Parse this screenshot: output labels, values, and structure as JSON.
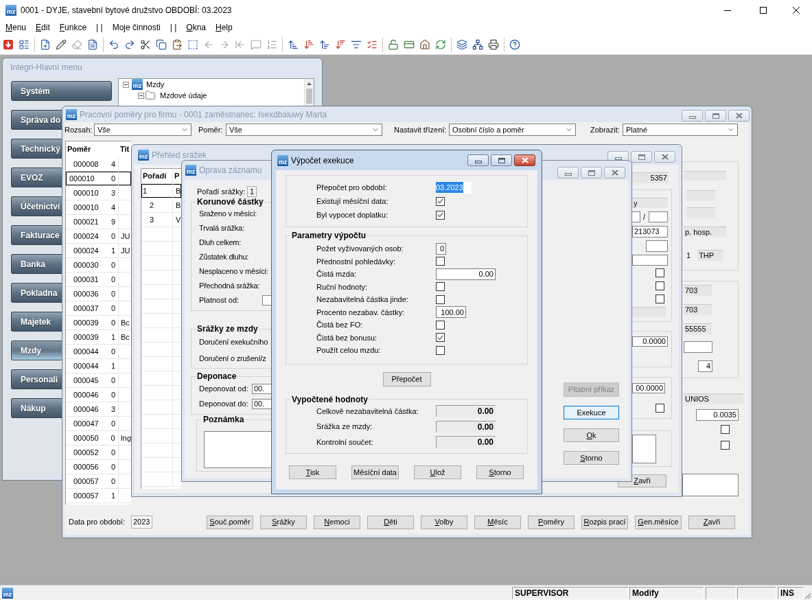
{
  "app": {
    "logo": "mz",
    "title": "0001 - DYJE, stavební bytové družstvo OBDOBÍ: 03.2023"
  },
  "menu_bar": [
    {
      "label": "Menu",
      "mnemonic": true
    },
    {
      "label": "Edit",
      "mnemonic": true
    },
    {
      "label": "Funkce",
      "mnemonic": true
    },
    {
      "label": "| |"
    },
    {
      "label": "Moje činnosti",
      "mnemonic": false
    },
    {
      "label": "| |"
    },
    {
      "label": "Okna",
      "mnemonic": true
    },
    {
      "label": "Help",
      "mnemonic": true
    }
  ],
  "toolbar": [
    {
      "items": [
        {
          "kind": "import",
          "disabled": false
        },
        {
          "kind": "form",
          "disabled": false
        }
      ]
    },
    {
      "items": [
        {
          "kind": "new",
          "disabled": false
        },
        {
          "kind": "edit",
          "disabled": false
        },
        {
          "kind": "erase",
          "disabled": true
        },
        {
          "kind": "list",
          "disabled": false
        }
      ]
    },
    {
      "items": [
        {
          "kind": "undo",
          "disabled": false
        },
        {
          "kind": "redo",
          "disabled": false
        },
        {
          "kind": "cut",
          "disabled": false
        },
        {
          "kind": "copy",
          "disabled": false
        },
        {
          "kind": "paste",
          "disabled": false
        },
        {
          "kind": "select",
          "disabled": false
        },
        {
          "kind": "back",
          "disabled": true
        },
        {
          "kind": "forward",
          "disabled": true
        },
        {
          "kind": "outdent",
          "disabled": true
        },
        {
          "kind": "comment",
          "disabled": true
        },
        {
          "kind": "numbered",
          "disabled": true
        }
      ]
    },
    {
      "items": [
        {
          "kind": "sort_up",
          "disabled": false
        },
        {
          "kind": "sort_down",
          "disabled": false
        },
        {
          "kind": "sort_up_wide",
          "disabled": false
        },
        {
          "kind": "sort_down_wide",
          "disabled": false
        },
        {
          "kind": "filter",
          "disabled": false
        },
        {
          "kind": "checklist",
          "disabled": false
        }
      ]
    },
    {
      "items": [
        {
          "kind": "unlock",
          "disabled": false
        },
        {
          "kind": "card",
          "disabled": false
        },
        {
          "kind": "home",
          "disabled": false
        },
        {
          "kind": "refresh",
          "disabled": false
        }
      ]
    },
    {
      "items": [
        {
          "kind": "layers",
          "disabled": false
        },
        {
          "kind": "network",
          "disabled": false
        },
        {
          "kind": "printer",
          "disabled": false
        }
      ]
    },
    {
      "items": [
        {
          "kind": "help",
          "disabled": false
        }
      ]
    }
  ],
  "main_menu": {
    "title": "Integri-Hlavní menu",
    "active": false,
    "modules": [
      {
        "label": "Systém",
        "selected": false
      },
      {
        "label": "Správa do",
        "selected": false
      },
      {
        "label": "Technický",
        "selected": false
      },
      {
        "label": "EVOZ",
        "selected": false
      },
      {
        "label": "Účetnictví",
        "selected": false
      },
      {
        "label": "Fakturace",
        "selected": false
      },
      {
        "label": "Banka",
        "selected": false
      },
      {
        "label": "Pokladna",
        "selected": false
      },
      {
        "label": "Majetek",
        "selected": false
      },
      {
        "label": "Mzdy",
        "selected": true
      },
      {
        "label": "Personali",
        "selected": false
      },
      {
        "label": "Nákup",
        "selected": false
      }
    ],
    "tree": [
      {
        "label": "Mzdy",
        "logo": "mz",
        "expanded": true,
        "children": [
          {
            "label": "Mzdové údaje",
            "expanded": true
          }
        ]
      }
    ]
  },
  "employment_window": {
    "logo": "mz",
    "title": "Pracovní poměry pro firmu - 0001 zaměstnanec: Isexdbaluwý Marta",
    "active": false,
    "filters": [
      {
        "label": "Rozsah:",
        "value": "Vše"
      },
      {
        "label": "Poměr:",
        "value": "Vše"
      },
      {
        "label": "Nastavit třízení:",
        "value": "Osobní číslo a poměr"
      },
      {
        "label": "Zobrazit:",
        "value": "Platné"
      }
    ],
    "table": {
      "columns": [
        "Poměr",
        "Tit"
      ],
      "rows": [
        {
          "number": "000008",
          "order": "4",
          "selected": false
        },
        {
          "number": "000010",
          "order": "0",
          "selected": true
        },
        {
          "number": "000010",
          "order": "3",
          "selected": false
        },
        {
          "number": "000010",
          "order": "4",
          "selected": false
        },
        {
          "number": "000021",
          "order": "9",
          "selected": false
        },
        {
          "number": "000024",
          "order": "0",
          "title": "JU",
          "selected": false
        },
        {
          "number": "000024",
          "order": "1",
          "title": "JU",
          "selected": false
        },
        {
          "number": "000030",
          "order": "0",
          "selected": false
        },
        {
          "number": "000031",
          "order": "0",
          "selected": false
        },
        {
          "number": "000036",
          "order": "0",
          "selected": false
        },
        {
          "number": "000037",
          "order": "0",
          "selected": false
        },
        {
          "number": "000039",
          "order": "0",
          "title": "Bc",
          "selected": false
        },
        {
          "number": "000039",
          "order": "1",
          "title": "Bc",
          "selected": false
        },
        {
          "number": "000044",
          "order": "0",
          "selected": false
        },
        {
          "number": "000044",
          "order": "1",
          "selected": false
        },
        {
          "number": "000045",
          "order": "0",
          "selected": false
        },
        {
          "number": "000046",
          "order": "0",
          "selected": false
        },
        {
          "number": "000046",
          "order": "3",
          "selected": false
        },
        {
          "number": "000047",
          "order": "0",
          "selected": false
        },
        {
          "number": "000050",
          "order": "0",
          "title": "Ing",
          "selected": false
        },
        {
          "number": "000052",
          "order": "0",
          "selected": false
        },
        {
          "number": "000056",
          "order": "0",
          "selected": false
        },
        {
          "number": "000057",
          "order": "0",
          "selected": false
        },
        {
          "number": "000057",
          "order": "1",
          "selected": false
        }
      ]
    },
    "details": [
      {
        "kind": "readonly"
      },
      {
        "kind": "readonly"
      },
      {
        "kind": "readonly"
      },
      {
        "kind": "readonly",
        "value": "p. hosp."
      },
      {
        "kind": "text",
        "value": "1"
      },
      {
        "kind": "readonly",
        "value": "THP"
      },
      {
        "kind": "readonly",
        "value": "703"
      },
      {
        "kind": "readonly",
        "value": "703"
      },
      {
        "kind": "readonly",
        "value": "55555"
      },
      {
        "kind": "input"
      },
      {
        "kind": "input",
        "value": "4"
      },
      {
        "kind": "readonly",
        "value": "UNIOS"
      },
      {
        "kind": "input",
        "value": "0.0035"
      },
      {
        "kind": "checkbox",
        "checked": false
      },
      {
        "kind": "checkbox",
        "checked": false
      },
      {
        "kind": "textarea"
      }
    ],
    "period": {
      "label": "Data pro období:",
      "value": "2023"
    },
    "buttons": [
      {
        "label": "Souč.poměr",
        "mnemonic": true
      },
      {
        "label": "Srážky",
        "mnemonic": true
      },
      {
        "label": "Nemoci",
        "mnemonic": true
      },
      {
        "label": "Děti",
        "mnemonic": true
      },
      {
        "label": "Volby",
        "mnemonic": true
      },
      {
        "label": "Měsíc",
        "mnemonic": true
      },
      {
        "label": "Poměry",
        "mnemonic": true
      },
      {
        "label": "Rozpis prací",
        "mnemonic": true
      },
      {
        "label": "Gen.měsíce",
        "mnemonic": true
      },
      {
        "label": "Zavři",
        "mnemonic": true
      }
    ]
  },
  "deductions_window": {
    "logo": "mz",
    "title": "Přehled srážek",
    "active": false,
    "table": {
      "columns": [
        "Pořadí",
        "P"
      ],
      "rows": [
        {
          "order": "1",
          "text": "B",
          "selected": true
        },
        {
          "order": "2",
          "text": "B",
          "selected": false
        },
        {
          "order": "3",
          "text": "V",
          "selected": false
        }
      ]
    },
    "details": [
      {
        "kind": "readonly",
        "value": "5357"
      },
      {
        "kind": "readonly",
        "value": "y"
      },
      {
        "kind": "input"
      },
      {
        "kind": "text",
        "value": "/"
      },
      {
        "kind": "input"
      },
      {
        "kind": "input",
        "value": "213073"
      },
      {
        "kind": "input"
      },
      {
        "kind": "input"
      },
      {
        "kind": "checkbox",
        "checked": false
      },
      {
        "kind": "checkbox",
        "checked": false
      },
      {
        "kind": "checkbox",
        "checked": false
      },
      {
        "kind": "readonly"
      },
      {
        "kind": "input",
        "value": "0.0000"
      },
      {
        "kind": "input",
        "value": "00.0000"
      },
      {
        "kind": "checkbox",
        "checked": false
      },
      {
        "kind": "textarea"
      }
    ],
    "buttons": [
      {
        "label": "Zavři",
        "mnemonic": true
      }
    ]
  },
  "edit_window": {
    "logo": "mz",
    "title": "Oprava záznamu",
    "active": false,
    "order": {
      "label": "Pořadí srážky:",
      "value": "1"
    },
    "groups": [
      {
        "title": "Korunové částky",
        "kind": "rows",
        "rows": [
          {
            "kind": "label",
            "label": "Sraženo v měsíci:"
          },
          {
            "kind": "label",
            "label": "Trvalá srážka:"
          },
          {
            "kind": "label",
            "label": "Dluh celkem:"
          },
          {
            "kind": "label",
            "label": "Zůstatek dluhu:"
          },
          {
            "kind": "label",
            "label": "Nesplaceno v měsíci:"
          },
          {
            "kind": "label",
            "label": "Přechodná srážka:"
          },
          {
            "kind": "field",
            "label": "Platnost od:"
          }
        ]
      },
      {
        "title": "Srážky ze mzdy",
        "kind": "rows",
        "rows": [
          {
            "kind": "label",
            "label": "Doručení exekučního"
          },
          {
            "kind": "label",
            "label": "Doručení o zrušení/z"
          }
        ]
      },
      {
        "title": "Deponace",
        "kind": "rows",
        "rows": [
          {
            "kind": "field",
            "label": "Deponovat od:",
            "value": "00."
          },
          {
            "kind": "field",
            "label": "Deponovat do:",
            "value": "00."
          }
        ]
      },
      {
        "title": "Poznámka",
        "kind": "note"
      }
    ],
    "buttons": [
      {
        "label": "Pltabní příkaz",
        "disabled": true,
        "focused": false,
        "mnemonic": false
      },
      {
        "label": "Exekuce",
        "disabled": false,
        "focused": true,
        "mnemonic": false
      },
      {
        "label": "Ok",
        "disabled": false,
        "focused": false,
        "mnemonic": true
      },
      {
        "label": "Storno",
        "disabled": false,
        "focused": false,
        "mnemonic": true
      }
    ]
  },
  "calc_dialog": {
    "logo": "mz",
    "title": "Výpočet exekuce",
    "active": true,
    "summary": [
      {
        "kind": "field",
        "label": "Přepočet pro období:",
        "value": "03.2023",
        "text_selected": true
      },
      {
        "kind": "checkbox",
        "label": "Existují měsíční data:",
        "checked": true
      },
      {
        "kind": "checkbox",
        "label": "Byl vypocet doplatku:",
        "checked": true
      }
    ],
    "parameters": {
      "title": "Parametry výpočtu",
      "rows": [
        {
          "kind": "field",
          "label": "Požet vyživovaných osob:",
          "value": "0"
        },
        {
          "kind": "checkbox",
          "label": "Přednostní pohledávky:",
          "checked": false
        },
        {
          "kind": "field",
          "label": "Čistá mzda:",
          "value": "0.00"
        },
        {
          "kind": "checkbox",
          "label": "Ruční hodnoty:",
          "checked": false
        },
        {
          "kind": "checkbox",
          "label": "Nezabavitelná částka jinde:",
          "checked": false
        },
        {
          "kind": "field",
          "label": "Procento nezabav. částky:",
          "value": "100.00"
        },
        {
          "kind": "checkbox",
          "label": "Čistá bez FO:",
          "checked": false
        },
        {
          "kind": "checkbox",
          "label": "Čistá bez bonusu:",
          "checked": true
        },
        {
          "kind": "checkbox",
          "label": "Použít celou mzdu:",
          "checked": false
        }
      ]
    },
    "recalculate": {
      "label": "Přepočet",
      "mnemonic": false
    },
    "results": {
      "title": "Vypočtené hodnoty",
      "rows": [
        {
          "label": "Celkově nezabavitelná částka:",
          "value": "0.00"
        },
        {
          "label": "Srážka ze mzdy:",
          "value": "0.00"
        },
        {
          "label": "Kontrolní součet:",
          "value": "0.00"
        }
      ]
    },
    "buttons": [
      {
        "label": "Tisk",
        "mnemonic": true
      },
      {
        "label": "Měsíční data",
        "mnemonic": false
      },
      {
        "label": "Ulož",
        "mnemonic": true
      },
      {
        "label": "Storno",
        "mnemonic": true
      }
    ]
  },
  "status_bar": {
    "logo": "mz",
    "cells": [
      "SUPERVISOR",
      "Modify",
      "INS"
    ]
  }
}
